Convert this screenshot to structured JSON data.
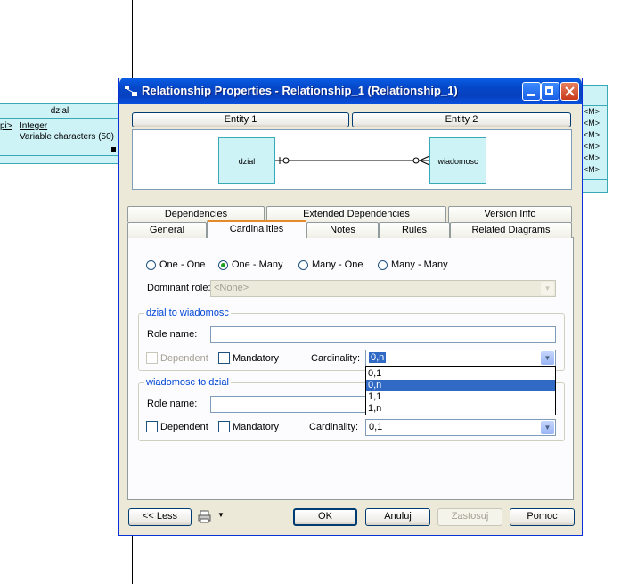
{
  "canvas": {
    "left_entity": {
      "name": "dzial",
      "pi_tag": "pi>",
      "attr1_type": "Integer",
      "attr2_type": "Variable characters (50)"
    },
    "right_entity": {
      "rows": [
        "<M>",
        "<M>",
        "<M>",
        "<M>",
        "<M>",
        "<M>"
      ]
    }
  },
  "window": {
    "title": "Relationship Properties - Relationship_1 (Relationship_1)",
    "entity1_button": "Entity 1",
    "entity2_button": "Entity 2",
    "preview": {
      "entity1": "dzial",
      "entity2": "wiadomosc"
    }
  },
  "tabs": {
    "row1": [
      "Dependencies",
      "Extended Dependencies",
      "Version Info"
    ],
    "row2": [
      "General",
      "Cardinalities",
      "Notes",
      "Rules",
      "Related Diagrams"
    ],
    "active": "Cardinalities"
  },
  "cardinalities": {
    "options": [
      "One - One",
      "One - Many",
      "Many - One",
      "Many - Many"
    ],
    "selected": "One - Many",
    "dominant_role_label": "Dominant role:",
    "dominant_role_value": "<None>",
    "group1": {
      "title": "dzial to wiadomosc",
      "role_name_label": "Role name:",
      "role_name_value": "",
      "dependent_label": "Dependent",
      "mandatory_label": "Mandatory",
      "cardinality_label": "Cardinality:",
      "cardinality_value": "0,n"
    },
    "group2": {
      "title": "wiadomosc to dzial",
      "role_name_label": "Role name:",
      "role_name_value": "",
      "dependent_label": "Dependent",
      "mandatory_label": "Mandatory",
      "cardinality_label": "Cardinality:",
      "cardinality_value": "0,1"
    },
    "dropdown_options": [
      "0,1",
      "0,n",
      "1,1",
      "1,n"
    ],
    "dropdown_highlighted": "0,n"
  },
  "footer": {
    "less_button": "<< Less",
    "ok_button": "OK",
    "cancel_button": "Anuluj",
    "apply_button": "Zastosuj",
    "help_button": "Pomoc"
  }
}
